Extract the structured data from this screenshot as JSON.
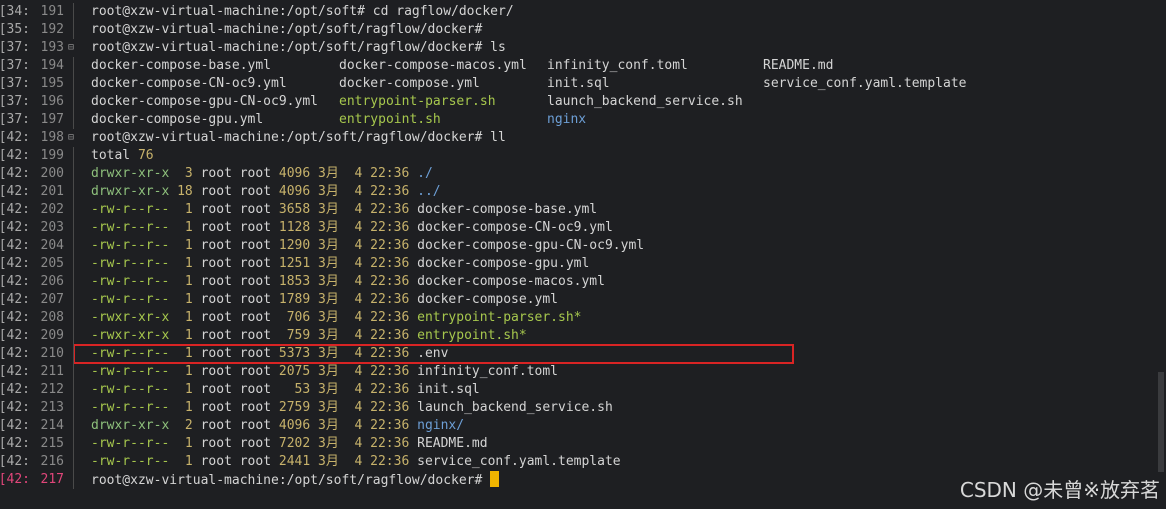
{
  "terminal": {
    "prompt_lines": [
      {
        "ts": ":34]",
        "ln": "191",
        "text": "root@xzw-virtual-machine:/opt/soft# cd ragflow/docker/"
      },
      {
        "ts": ":35]",
        "ln": "192",
        "text": "root@xzw-virtual-machine:/opt/soft/ragflow/docker#"
      },
      {
        "ts": ":37]",
        "ln": "193",
        "text": "root@xzw-virtual-machine:/opt/soft/ragflow/docker# ls"
      }
    ],
    "ls_rows": [
      {
        "ts": ":37]",
        "ln": "194",
        "cols": [
          "docker-compose-base.yml",
          "docker-compose-macos.yml",
          "infinity_conf.toml",
          "README.md"
        ],
        "types": [
          "plain",
          "plain",
          "plain",
          "plain"
        ]
      },
      {
        "ts": ":37]",
        "ln": "195",
        "cols": [
          "docker-compose-CN-oc9.yml",
          "docker-compose.yml",
          "init.sql",
          "service_conf.yaml.template"
        ],
        "types": [
          "plain",
          "plain",
          "plain",
          "plain"
        ]
      },
      {
        "ts": ":37]",
        "ln": "196",
        "cols": [
          "docker-compose-gpu-CN-oc9.yml",
          "entrypoint-parser.sh",
          "launch_backend_service.sh",
          ""
        ],
        "types": [
          "plain",
          "exe",
          "plain",
          "plain"
        ]
      },
      {
        "ts": ":37]",
        "ln": "197",
        "cols": [
          "docker-compose-gpu.yml",
          "entrypoint.sh",
          "nginx",
          ""
        ],
        "types": [
          "plain",
          "exe",
          "dir",
          "plain"
        ]
      }
    ],
    "ll_prompt": {
      "ts": ":42]",
      "ln": "198",
      "text": "root@xzw-virtual-machine:/opt/soft/ragflow/docker# ll"
    },
    "total": {
      "ts": ":42]",
      "ln": "199",
      "label": "total ",
      "value": "76"
    },
    "ll_rows": [
      {
        "ts": ":42]",
        "ln": "200",
        "perm": "drwxr-xr-x",
        "links": " 3",
        "owner": "root root",
        "size": "4096",
        "month": "3月",
        "day": " 4",
        "time": "22:36",
        "name": "./",
        "type": "dir"
      },
      {
        "ts": ":42]",
        "ln": "201",
        "perm": "drwxr-xr-x",
        "links": "18",
        "owner": "root root",
        "size": "4096",
        "month": "3月",
        "day": " 4",
        "time": "22:36",
        "name": "../",
        "type": "dir"
      },
      {
        "ts": ":42]",
        "ln": "202",
        "perm": "-rw-r--r--",
        "links": " 1",
        "owner": "root root",
        "size": "3658",
        "month": "3月",
        "day": " 4",
        "time": "22:36",
        "name": "docker-compose-base.yml",
        "type": "plain"
      },
      {
        "ts": ":42]",
        "ln": "203",
        "perm": "-rw-r--r--",
        "links": " 1",
        "owner": "root root",
        "size": "1128",
        "month": "3月",
        "day": " 4",
        "time": "22:36",
        "name": "docker-compose-CN-oc9.yml",
        "type": "plain"
      },
      {
        "ts": ":42]",
        "ln": "204",
        "perm": "-rw-r--r--",
        "links": " 1",
        "owner": "root root",
        "size": "1290",
        "month": "3月",
        "day": " 4",
        "time": "22:36",
        "name": "docker-compose-gpu-CN-oc9.yml",
        "type": "plain"
      },
      {
        "ts": ":42]",
        "ln": "205",
        "perm": "-rw-r--r--",
        "links": " 1",
        "owner": "root root",
        "size": "1251",
        "month": "3月",
        "day": " 4",
        "time": "22:36",
        "name": "docker-compose-gpu.yml",
        "type": "plain"
      },
      {
        "ts": ":42]",
        "ln": "206",
        "perm": "-rw-r--r--",
        "links": " 1",
        "owner": "root root",
        "size": "1853",
        "month": "3月",
        "day": " 4",
        "time": "22:36",
        "name": "docker-compose-macos.yml",
        "type": "plain"
      },
      {
        "ts": ":42]",
        "ln": "207",
        "perm": "-rw-r--r--",
        "links": " 1",
        "owner": "root root",
        "size": "1789",
        "month": "3月",
        "day": " 4",
        "time": "22:36",
        "name": "docker-compose.yml",
        "type": "plain"
      },
      {
        "ts": ":42]",
        "ln": "208",
        "perm": "-rwxr-xr-x",
        "links": " 1",
        "owner": "root root",
        "size": " 706",
        "month": "3月",
        "day": " 4",
        "time": "22:36",
        "name": "entrypoint-parser.sh*",
        "type": "exe"
      },
      {
        "ts": ":42]",
        "ln": "209",
        "perm": "-rwxr-xr-x",
        "links": " 1",
        "owner": "root root",
        "size": " 759",
        "month": "3月",
        "day": " 4",
        "time": "22:36",
        "name": "entrypoint.sh*",
        "type": "exe"
      },
      {
        "ts": ":42]",
        "ln": "210",
        "perm": "-rw-r--r--",
        "links": " 1",
        "owner": "root root",
        "size": "5373",
        "month": "3月",
        "day": " 4",
        "time": "22:36",
        "name": ".env",
        "type": "plain"
      },
      {
        "ts": ":42]",
        "ln": "211",
        "perm": "-rw-r--r--",
        "links": " 1",
        "owner": "root root",
        "size": "2075",
        "month": "3月",
        "day": " 4",
        "time": "22:36",
        "name": "infinity_conf.toml",
        "type": "plain"
      },
      {
        "ts": ":42]",
        "ln": "212",
        "perm": "-rw-r--r--",
        "links": " 1",
        "owner": "root root",
        "size": "  53",
        "month": "3月",
        "day": " 4",
        "time": "22:36",
        "name": "init.sql",
        "type": "plain"
      },
      {
        "ts": ":42]",
        "ln": "213",
        "perm": "-rw-r--r--",
        "links": " 1",
        "owner": "root root",
        "size": "2759",
        "month": "3月",
        "day": " 4",
        "time": "22:36",
        "name": "launch_backend_service.sh",
        "type": "plain"
      },
      {
        "ts": ":42]",
        "ln": "214",
        "perm": "drwxr-xr-x",
        "links": " 2",
        "owner": "root root",
        "size": "4096",
        "month": "3月",
        "day": " 4",
        "time": "22:36",
        "name": "nginx/",
        "type": "dir"
      },
      {
        "ts": ":42]",
        "ln": "215",
        "perm": "-rw-r--r--",
        "links": " 1",
        "owner": "root root",
        "size": "7202",
        "month": "3月",
        "day": " 4",
        "time": "22:36",
        "name": "README.md",
        "type": "plain"
      },
      {
        "ts": ":42]",
        "ln": "216",
        "perm": "-rw-r--r--",
        "links": " 1",
        "owner": "root root",
        "size": "2441",
        "month": "3月",
        "day": " 4",
        "time": "22:36",
        "name": "service_conf.yaml.template",
        "type": "plain"
      }
    ],
    "current_prompt": {
      "ts": ":42]",
      "ln": "217",
      "text": "root@xzw-virtual-machine:/opt/soft/ragflow/docker# "
    }
  },
  "watermark": "CSDN @未曾※放弃茗",
  "colors": {
    "dir": "#6d9fd6",
    "exe": "#a6c74d",
    "highlight_box": "#d92424",
    "cursor": "#f0b400"
  }
}
